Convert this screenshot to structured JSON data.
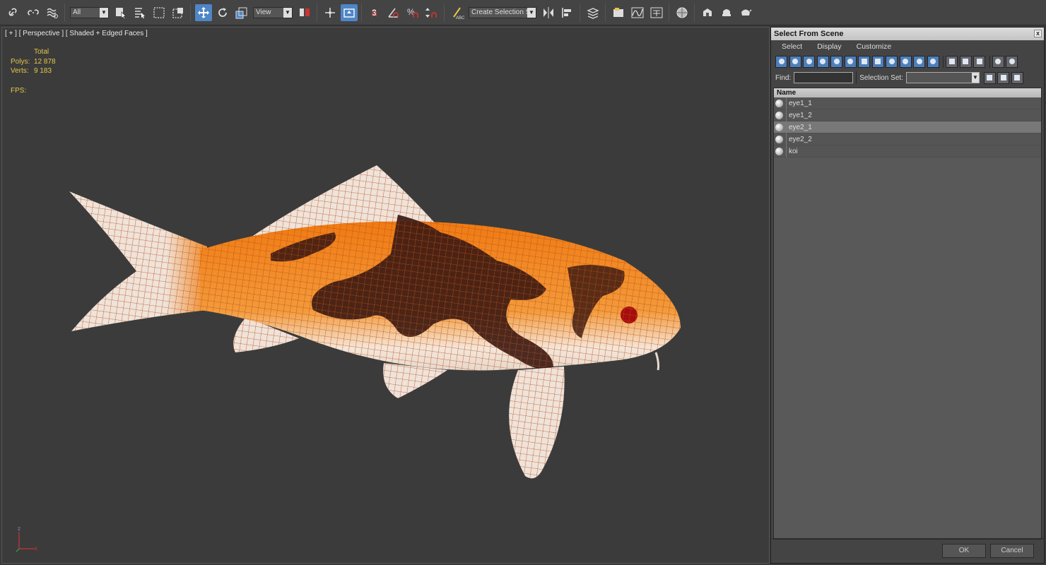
{
  "toolbar": {
    "filter_value": "All",
    "refcoord_value": "View",
    "snap_label": "3",
    "named_selection_placeholder": "Create Selection Se"
  },
  "viewport": {
    "label": "[ + ] [ Perspective ] [ Shaded + Edged Faces ]",
    "stats": {
      "header": "Total",
      "polys_label": "Polys:",
      "polys_value": "12 878",
      "verts_label": "Verts:",
      "verts_value": "9 183",
      "fps_label": "FPS:"
    },
    "axis": {
      "z": "z",
      "x": "x"
    }
  },
  "dialog": {
    "title": "Select From Scene",
    "close": "x",
    "menu": [
      "Select",
      "Display",
      "Customize"
    ],
    "find_label": "Find:",
    "selection_set_label": "Selection Set:",
    "column_name": "Name",
    "items": [
      {
        "name": "eye1_1",
        "selected": false
      },
      {
        "name": "eye1_2",
        "selected": false
      },
      {
        "name": "eye2_1",
        "selected": true
      },
      {
        "name": "eye2_2",
        "selected": false
      },
      {
        "name": "koi",
        "selected": false
      }
    ],
    "ok_label": "OK",
    "cancel_label": "Cancel"
  },
  "colors": {
    "accent": "#4f86c6",
    "stats": "#e6c64a",
    "wire": "#b8501a"
  }
}
